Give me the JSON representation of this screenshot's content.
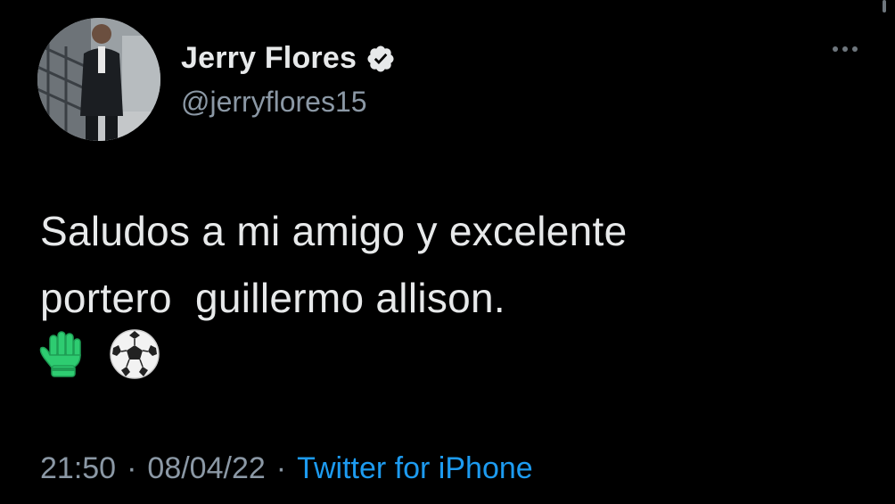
{
  "author": {
    "display_name": "Jerry Flores",
    "handle": "@jerryflores15",
    "verified": true,
    "avatar_icon": "profile-photo"
  },
  "tweet": {
    "text": "Saludos a mi amigo y excelente\nportero  guillermo allison.",
    "emojis": [
      "goalkeeper-glove-icon",
      "soccer-ball-icon"
    ]
  },
  "meta": {
    "time": "21:50",
    "separator_1": "·",
    "date": "08/04/22",
    "separator_2": "·",
    "source": "Twitter for iPhone"
  },
  "colors": {
    "background": "#000000",
    "text": "#e7e9ea",
    "secondary_text": "#8b98a5",
    "link": "#1d9bf0",
    "verified_badge": "#e7e9ea",
    "glove": "#2ecc71"
  }
}
